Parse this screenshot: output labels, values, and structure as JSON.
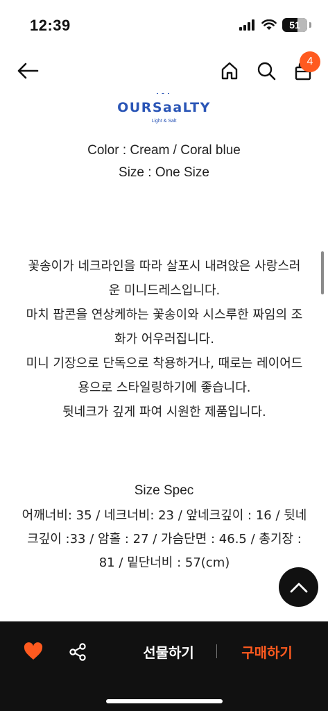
{
  "status": {
    "time": "12:39",
    "battery": "51"
  },
  "nav": {
    "cart_count": "4"
  },
  "brand": {
    "name": "OURSaaLTY",
    "tagline": "Light & Salt"
  },
  "product": {
    "color_line": "Color : Cream / Coral blue",
    "size_line": "Size : One Size",
    "description": [
      "꽃송이가 네크라인을 따라 살포시 내려앉은 사랑스러",
      "운 미니드레스입니다.",
      "마치 팝콘을 연상케하는 꽃송이와 시스루한 짜임의 조",
      "화가 어우러집니다.",
      "미니 기장으로 단독으로 착용하거나, 때로는 레이어드",
      "용으로 스타일링하기에 좋습니다.",
      "뒷네크가 깊게 파여 시원한 제품입니다."
    ],
    "spec_title": "Size Spec",
    "spec_lines": [
      "어깨너비: 35 / 네크너비: 23 / 앞네크깊이 : 16 / 뒷네",
      "크깊이 :33 / 암홀 : 27 / 가슴단면 : 46.5  / 총기장 :",
      "81 / 밑단너비 : 57(cm)"
    ]
  },
  "actions": {
    "gift_label": "선물하기",
    "buy_label": "구매하기"
  },
  "colors": {
    "accent": "#ff5a1f",
    "brand_blue": "#2a55b6",
    "bar_bg": "#111111"
  },
  "icons": [
    "back-arrow-icon",
    "home-icon",
    "search-icon",
    "shopping-bag-icon",
    "heart-icon",
    "share-icon",
    "chevron-up-icon"
  ]
}
